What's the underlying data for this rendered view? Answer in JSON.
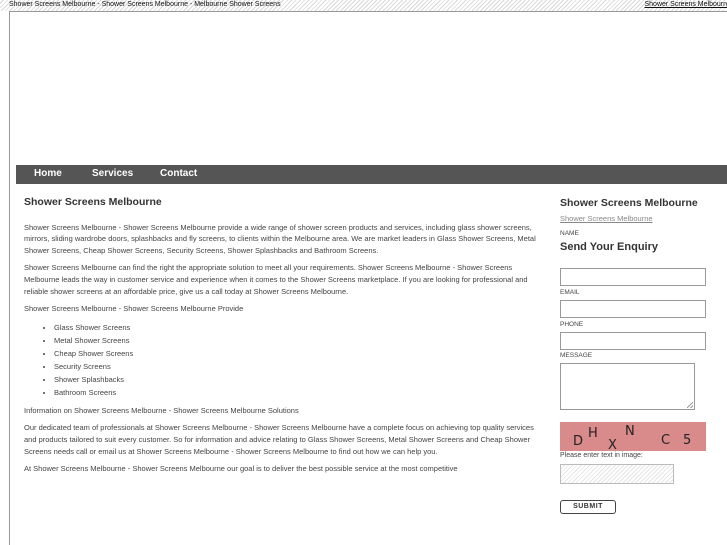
{
  "topbar": {
    "left_text": "Shower Screens Melbourne - Shower Screens Melbourne - Melbourne Shower Screens",
    "right_link": "Shower Screens Melbourn"
  },
  "nav": {
    "items": [
      "Home",
      "Services",
      "Contact"
    ]
  },
  "main": {
    "title": "Shower Screens Melbourne",
    "p1": "Shower Screens Melbourne - Shower Screens Melbourne provide a wide range of shower screen products and services, including glass shower screens, mirrors, sliding wardrobe doors, splashbacks and fly screens, to clients within the Melbourne area. We are market leaders in Glass Shower Screens, Metal Shower Screens, Cheap Shower Screens, Security Screens, Shower Splashbacks and Bathroom Screens.",
    "p2": "Shower Screens Melbourne can find the right the appropriate solution to meet all your requirements. Shower Screens Melbourne - Shower Screens Melbourne leads the way in customer service and experience when it comes to the Shower Screens marketplace. If you are looking for professional and reliable shower screens at an affordable price, give us a call today at Shower Screens Melbourne.",
    "p3": "Shower Screens Melbourne - Shower Screens Melbourne Provide",
    "list": [
      "Glass Shower Screens",
      "Metal Shower Screens",
      "Cheap Shower Screens",
      "Security Screens",
      "Shower Splashbacks",
      "Bathroom Screens"
    ],
    "p4": "Information on Shower Screens Melbourne - Shower Screens Melbourne Solutions",
    "p5": "Our dedicated team of professionals at Shower Screens Melbourne - Shower Screens Melbourne have a complete focus on achieving top quality services and products tailored to suit every customer. So for information and advice relating to Glass Shower Screens, Metal Shower Screens and Cheap Shower Screens needs call or email us at Shower Screens Melbourne - Shower Screens Melbourne to find out how we can help you.",
    "p6": "At Shower Screens Melbourne - Shower Screens Melbourne our goal is to deliver the best possible service at the most competitive"
  },
  "side": {
    "title": "Shower Screens Melbourne",
    "link": "Shower Screens Melbourne",
    "enquiry_title": "Send Your Enquiry",
    "name_label": "NAME",
    "email_label": "EMAIL",
    "phone_label": "PHONE",
    "message_label": "MESSAGE",
    "captcha_text": "DHXNC5",
    "captcha_prompt": "Please enter text in image:",
    "submit_label": "SUBMIT"
  }
}
